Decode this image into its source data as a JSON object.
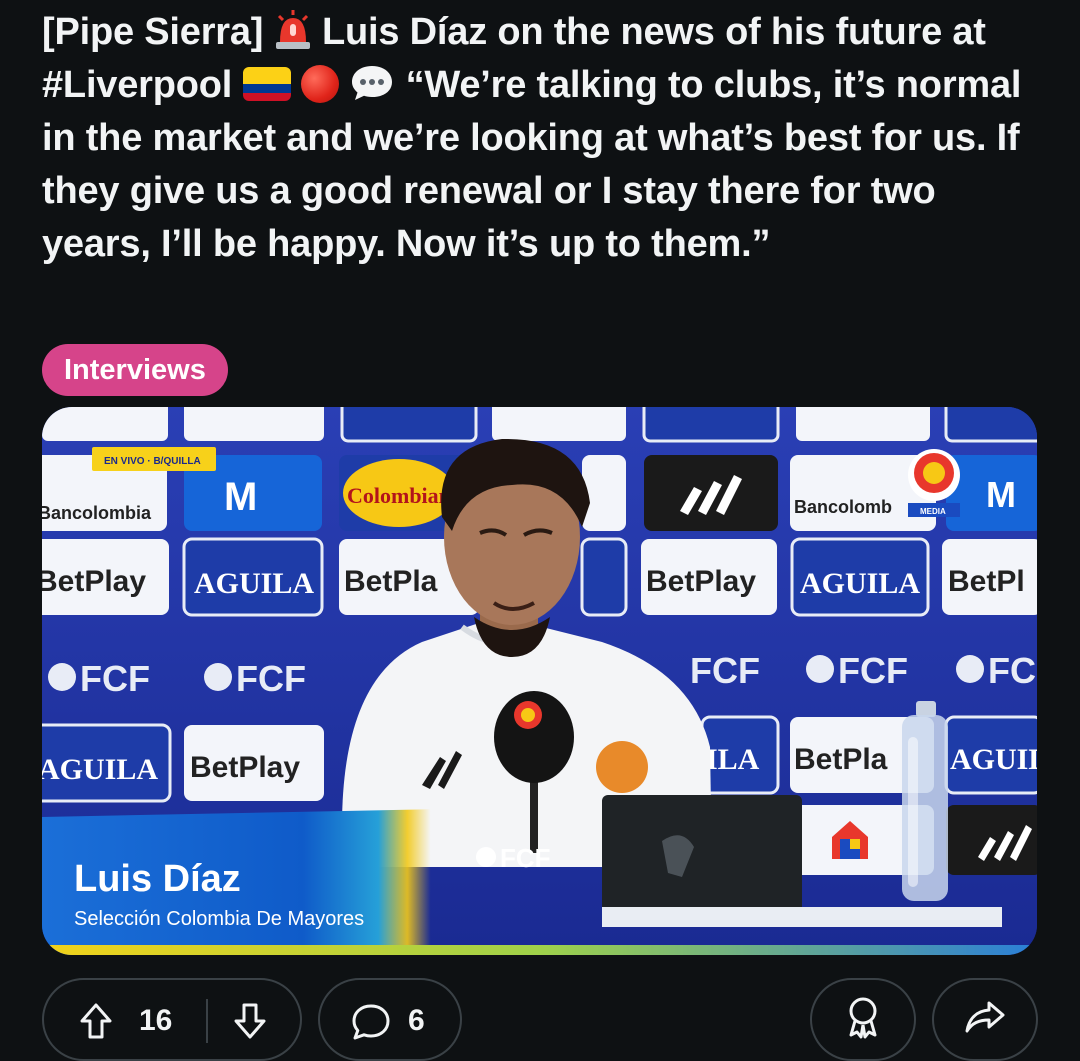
{
  "post": {
    "title_part1": "[Pipe Sierra] ",
    "title_part2": " Luis Díaz on the news of his future at #Liverpool ",
    "title_part3": " “We’re talking to clubs, it’s normal in the market and we’re looking at what’s best for us. If they give us a good renewal or I stay there for two years, I’ll be happy. Now it’s up to them.”",
    "flair": "Interviews",
    "flair_color": "#d6448a"
  },
  "media": {
    "live_tag": "EN VIVO · B/QUILLA",
    "lower_third_name": "Luis Díaz",
    "lower_third_subtitle": "Selección Colombia De Mayores",
    "fcf_label": "FCF",
    "sponsors": {
      "betplay": "BetPlay",
      "aguila": "AGUILA",
      "bancolombia": "Bancolombia",
      "colombiana": "Colombiana",
      "fcf": "FCF"
    }
  },
  "actions": {
    "upvote_count": "16",
    "comment_count": "6",
    "icons": {
      "upvote": "upvote-arrow-icon",
      "downvote": "downvote-arrow-icon",
      "comment": "comment-bubble-icon",
      "award": "award-icon",
      "share": "share-arrow-icon"
    }
  },
  "colors": {
    "background": "#0e1113",
    "text": "#f2f4f5",
    "pill_border": "#3a4146"
  }
}
